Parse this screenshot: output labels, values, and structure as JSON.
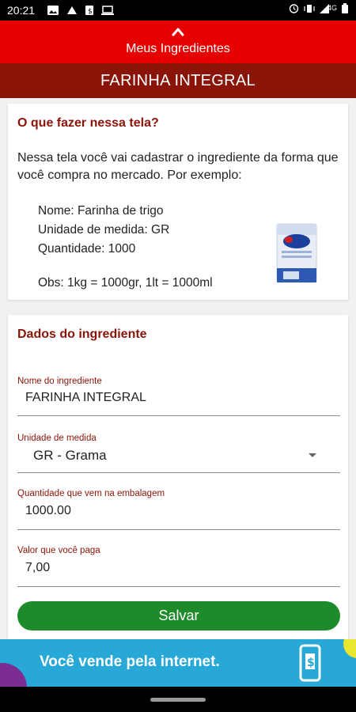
{
  "status_bar": {
    "time": "20:21",
    "network": "4G"
  },
  "header": {
    "back_label": "Meus Ingredientes",
    "icon": "chevron-up-icon"
  },
  "title_bar": {
    "title": "FARINHA INTEGRAL"
  },
  "help_card": {
    "title": "O que fazer nessa tela?",
    "intro": "Nessa tela você vai cadastrar o ingrediente da forma que você compra no mercado. Por exemplo:",
    "example_name": "Nome: Farinha de trigo",
    "example_unit": "Unidade de medida: GR",
    "example_qty": "Quantidade: 1000",
    "example_obs": "Obs: 1kg = 1000gr, 1lt = 1000ml"
  },
  "form_card": {
    "title": "Dados do ingrediente",
    "fields": [
      {
        "label": "Nome do ingrediente",
        "value": "FARINHA INTEGRAL"
      },
      {
        "label": "Unidade de medida",
        "value": "GR - Grama"
      },
      {
        "label": "Quantidade que vem na embalagem",
        "value": "1000.00"
      },
      {
        "label": "Valor que você paga",
        "value": "7,00"
      }
    ],
    "save_label": "Salvar"
  },
  "ad_banner": {
    "text": "Você vende pela internet."
  },
  "colors": {
    "header_red": "#e60000",
    "title_maroon": "#8b1409",
    "save_green": "#1e8b2a",
    "ad_blue": "#27a8d6"
  }
}
